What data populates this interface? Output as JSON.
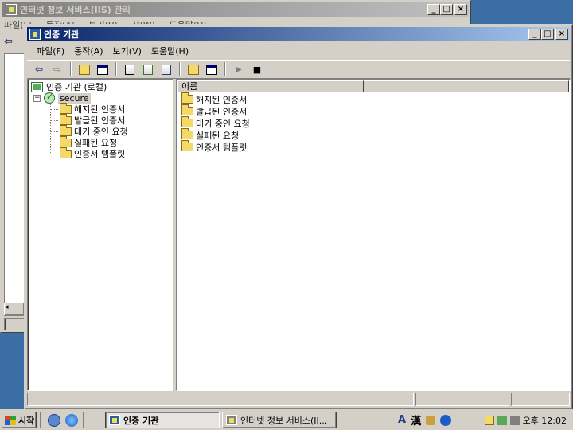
{
  "background_window": {
    "title": "인터넷 정보 서비스(IIS) 관리",
    "menu": [
      "파일(F)",
      "동작(A)",
      "보기(V)",
      "창(W)",
      "도움말(H)"
    ]
  },
  "main_window": {
    "title": "인증 기관",
    "menu": [
      {
        "label": "파일",
        "key": "(F)"
      },
      {
        "label": "동작",
        "key": "(A)"
      },
      {
        "label": "보기",
        "key": "(V)"
      },
      {
        "label": "도움말",
        "key": "(H)"
      }
    ],
    "toolbar_icons": [
      "back-icon",
      "forward-icon",
      "up-folder-icon",
      "show-tree-icon",
      "properties-icon",
      "refresh-icon",
      "export-list-icon",
      "help-icon",
      "console-tree-icon",
      "play-icon",
      "stop-icon"
    ],
    "tree": {
      "root": "인증 기관 (로컬)",
      "ca_name": "secure",
      "children": [
        "해지된 인증서",
        "발급된 인증서",
        "대기 중인 요청",
        "실패된 요청",
        "인증서 템플릿"
      ]
    },
    "list": {
      "column_header": "이름",
      "items": [
        "해지된 인증서",
        "발급된 인증서",
        "대기 중인 요청",
        "실패된 요청",
        "인증서 템플릿"
      ]
    }
  },
  "taskbar": {
    "start_label": "시작",
    "tasks": [
      {
        "label": "인증 기관",
        "active": true
      },
      {
        "label": "인터넷 정보 서비스(II...",
        "active": false
      }
    ],
    "ime": [
      "A",
      "漢"
    ],
    "clock": "오후 12:02"
  },
  "colors": {
    "desktop": "#3a6ea5",
    "active_title_start": "#0a246a",
    "active_title_end": "#a6caf0",
    "face": "#d4d0c8"
  }
}
